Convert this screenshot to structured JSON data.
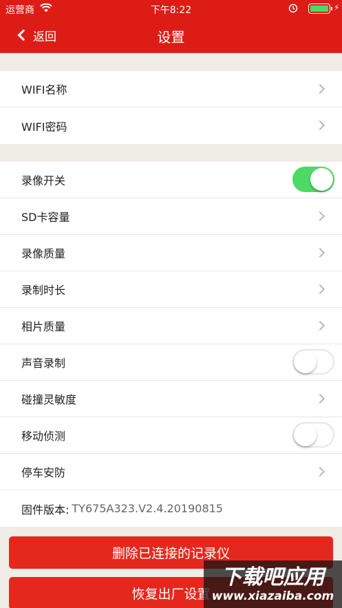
{
  "status_bar": {
    "carrier": "运营商",
    "time": "下午8:22",
    "battery_level": 1.0
  },
  "nav": {
    "back_label": "返回",
    "title": "设置"
  },
  "wifi_group": [
    {
      "label": "WIFI名称"
    },
    {
      "label": "WIFI密码"
    }
  ],
  "settings_group": {
    "record_switch": {
      "label": "录像开关",
      "on": true
    },
    "sd_capacity": {
      "label": "SD卡容量"
    },
    "video_quality": {
      "label": "录像质量"
    },
    "record_duration": {
      "label": "录制时长"
    },
    "photo_quality": {
      "label": "相片质量"
    },
    "sound_record": {
      "label": "声音录制",
      "on": false
    },
    "collision_sensitivity": {
      "label": "碰撞灵敏度"
    },
    "motion_detect": {
      "label": "移动侦测",
      "on": false
    },
    "parking_guard": {
      "label": "停车安防"
    },
    "firmware": {
      "label": "固件版本:",
      "value": "TY675A323.V2.4.20190815"
    }
  },
  "buttons": {
    "delete_label": "删除已连接的记录仪",
    "reset_label": "恢复出厂设置"
  },
  "watermark": {
    "logo": "下载吧应用",
    "url": "www.xiazaiba.com"
  },
  "colors": {
    "header": "#de1c16",
    "button": "#e5281d",
    "toggle_on": "#4cd964",
    "background": "#f0ece6"
  }
}
